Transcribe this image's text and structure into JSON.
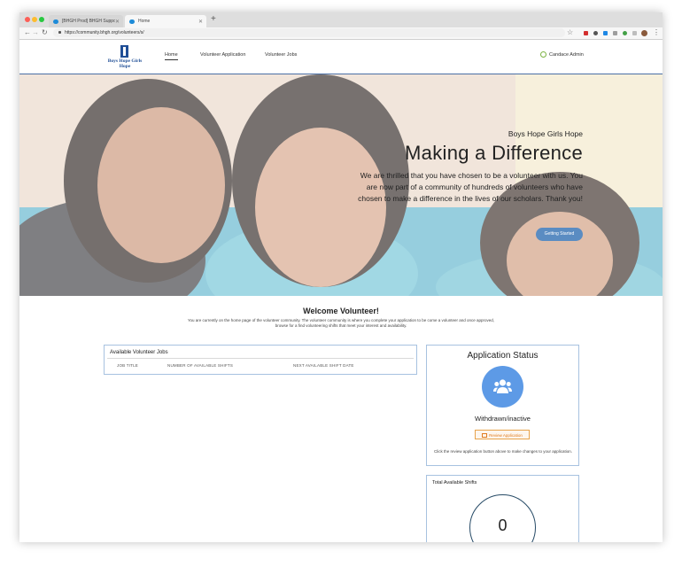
{
  "browser": {
    "tabs": [
      {
        "label": "[BHGH Prod] BHGH Support C"
      },
      {
        "label": "Home"
      }
    ],
    "new_tab": "+",
    "url": "https://community.bhgh.org/volunteers/s/"
  },
  "site": {
    "logo_text": "Boys Hope Girls Hope",
    "nav": {
      "home": "Home",
      "volunteer_application": "Volunteer Application",
      "volunteer_jobs": "Volunteer Jobs"
    },
    "user_name": "Candace Admin"
  },
  "hero": {
    "subtitle": "Boys Hope Girls Hope",
    "title": "Making a Difference",
    "text": "We are thrilled that you have chosen to be a volunteer with us. You are now part of a community of hundreds of volunteers who have chosen to make a difference in the lives of our scholars. Thank you!",
    "button": "Getting Started"
  },
  "welcome": {
    "title": "Welcome Volunteer!",
    "text": "You are currently on the home page of the volunteer community. The volunteer community is where you complete your application to be come a volunteer and once approved, browse for a find volunteering shifts that meet your interest and availability."
  },
  "jobs_panel": {
    "title": "Available Volunteer Jobs",
    "columns": [
      "JOB TITLE",
      "NUMBER OF AVAILABLE SHIFTS",
      "NEXT AVAILABLE SHIFT DATE"
    ]
  },
  "application_status": {
    "title": "Application Status",
    "icon": "group-icon",
    "status": "Withdrawn/inactive",
    "button": "Review Application",
    "note": "Click the review application button above to make changes to your application."
  },
  "total_shifts": {
    "title": "Total Available Shifts",
    "value": "0"
  },
  "colors": {
    "accent": "#5a8cc2",
    "brand": "#1f4e96",
    "panel_border": "#a7c2e0",
    "review_orange": "#e07b1f"
  }
}
